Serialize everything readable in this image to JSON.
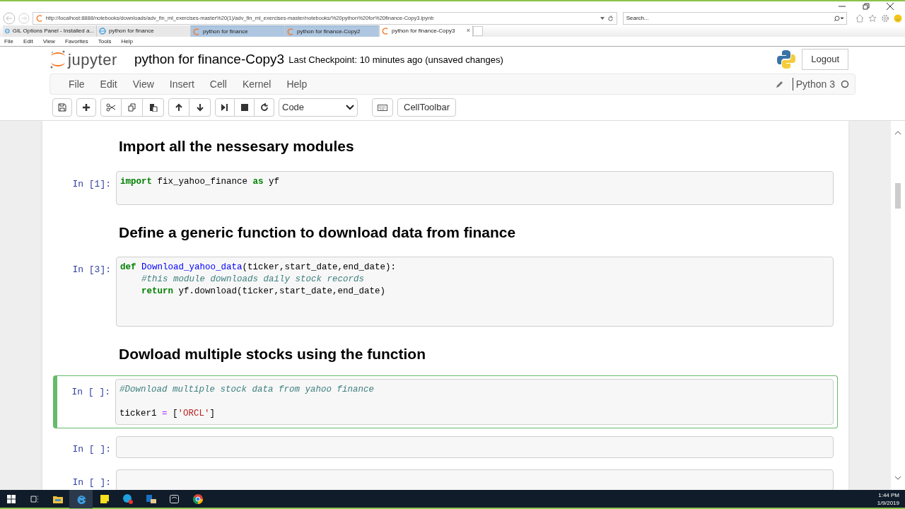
{
  "browser": {
    "address": "http://localhost:8888/notebooks/downloads/adv_fin_ml_exercises-master%20(1)/adv_fin_ml_exercises-master/notebooks/%20python%20for%20finance-Copy3.ipynb",
    "search": {
      "placeholder": "Search..."
    },
    "tabs": [
      {
        "label": "GIL Options Panel - Installed a...",
        "selected": false,
        "grouped": false,
        "kind": "ie"
      },
      {
        "label": "python for finance",
        "selected": false,
        "grouped": false,
        "kind": "ie"
      },
      {
        "label": "python for finance",
        "selected": false,
        "grouped": true,
        "kind": "jupyter"
      },
      {
        "label": "python for finance-Copy2",
        "selected": false,
        "grouped": true,
        "kind": "jupyter"
      },
      {
        "label": "python for finance-Copy3",
        "selected": true,
        "grouped": false,
        "kind": "jupyter",
        "close": "×"
      }
    ],
    "menu": [
      "File",
      "Edit",
      "View",
      "Favorites",
      "Tools",
      "Help"
    ]
  },
  "notebook": {
    "logo": "jupyter",
    "title": "python for finance-Copy3",
    "checkpoint": "Last Checkpoint: 10 minutes ago (unsaved changes)",
    "logout": "Logout",
    "menu": [
      "File",
      "Edit",
      "View",
      "Insert",
      "Cell",
      "Kernel",
      "Help"
    ],
    "kernel": "Python 3",
    "cell_type": "Code",
    "celltoolbar": "CellToolbar"
  },
  "cells": [
    {
      "kind": "markdown",
      "text": "Import all the nessesary modules"
    },
    {
      "kind": "code",
      "prompt": "In [1]:",
      "selected": false,
      "lines": [
        {
          "tokens": [
            {
              "text": "import",
              "kind": "keyword"
            },
            {
              "text": " fix_yahoo_finance ",
              "kind": "plain"
            },
            {
              "text": "as",
              "kind": "keyword"
            },
            {
              "text": " yf",
              "kind": "plain"
            }
          ]
        },
        {
          "blank": true
        }
      ]
    },
    {
      "kind": "markdown",
      "text": "Define a generic function to download data from finance"
    },
    {
      "kind": "code",
      "prompt": "In [3]:",
      "selected": false,
      "lines": [
        {
          "tokens": [
            {
              "text": "def",
              "kind": "keyword"
            },
            {
              "text": " Download_yahoo_data",
              "kind": "def"
            },
            {
              "text": "(ticker,start_date,end_date):",
              "kind": "plain"
            }
          ]
        },
        {
          "tokens": [
            {
              "text": "    #this module downloads daily stock records",
              "kind": "comment"
            }
          ]
        },
        {
          "tokens": [
            {
              "text": "    return",
              "kind": "keyword"
            },
            {
              "text": " yf.download(ticker,start_date,end_date)",
              "kind": "plain"
            }
          ]
        },
        {
          "blank": true
        },
        {
          "blank": true
        }
      ]
    },
    {
      "kind": "markdown",
      "text": "Dowload multiple stocks using the function"
    },
    {
      "kind": "code",
      "prompt": "In [ ]:",
      "selected": true,
      "lines": [
        {
          "tokens": [
            {
              "text": "#Download multiple stock data from yahoo finance",
              "kind": "comment"
            }
          ]
        },
        {
          "blank": true
        },
        {
          "tokens": [
            {
              "text": "ticker1 ",
              "kind": "plain"
            },
            {
              "text": "=",
              "kind": "operator"
            },
            {
              "text": " [",
              "kind": "plain"
            },
            {
              "text": "'ORCL'",
              "kind": "string"
            },
            {
              "text": "]",
              "kind": "plain"
            }
          ]
        }
      ]
    },
    {
      "kind": "code",
      "prompt": "In [ ]:",
      "selected": false,
      "lines": [
        {
          "blank": true
        }
      ]
    },
    {
      "kind": "code",
      "prompt": "In [ ]:",
      "selected": false,
      "lines": [
        {
          "blank": true
        }
      ]
    }
  ],
  "taskbar": {
    "time": "1:44 PM",
    "date": "1/9/2019"
  }
}
